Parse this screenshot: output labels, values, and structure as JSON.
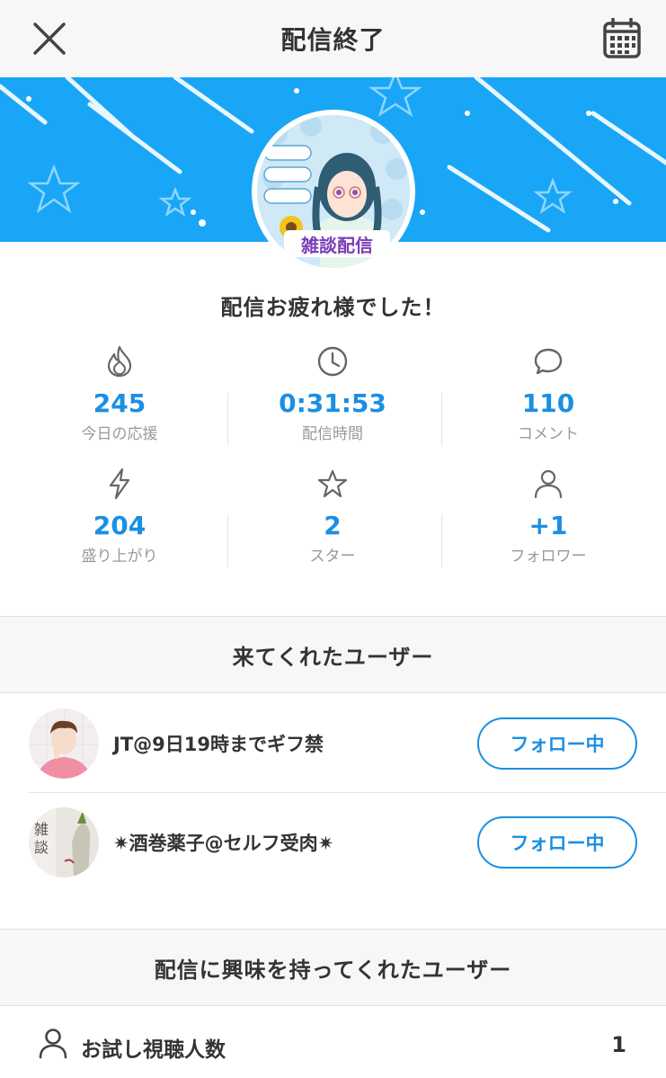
{
  "header": {
    "title": "配信終了",
    "close_icon": "close-icon",
    "calendar_icon": "calendar-icon"
  },
  "banner": {
    "color": "#19a6f6",
    "avatar_text": "雑談配信"
  },
  "thanks_message": "配信お疲れ様でした！",
  "stats": [
    {
      "icon": "flame-icon",
      "value": "245",
      "label": "今日の応援"
    },
    {
      "icon": "clock-icon",
      "value": "0:31:53",
      "label": "配信時間"
    },
    {
      "icon": "comment-icon",
      "value": "110",
      "label": "コメント"
    },
    {
      "icon": "lightning-icon",
      "value": "204",
      "label": "盛り上がり"
    },
    {
      "icon": "star-icon",
      "value": "2",
      "label": "スター"
    },
    {
      "icon": "person-icon",
      "value": "+1",
      "label": "フォロワー"
    }
  ],
  "visitors_section": {
    "title": "来てくれたユーザー",
    "users": [
      {
        "name": "JT@9日19時までギフ禁",
        "button": "フォロー中"
      },
      {
        "name": "✷酒巻薬子@セルフ受肉✷",
        "button": "フォロー中"
      }
    ]
  },
  "interested_section": {
    "title": "配信に興味を持ってくれたユーザー",
    "trial_label": "お試し視聴人数",
    "trial_value": "1"
  },
  "colors": {
    "accent": "#1a8fe3",
    "banner": "#19a6f6"
  }
}
